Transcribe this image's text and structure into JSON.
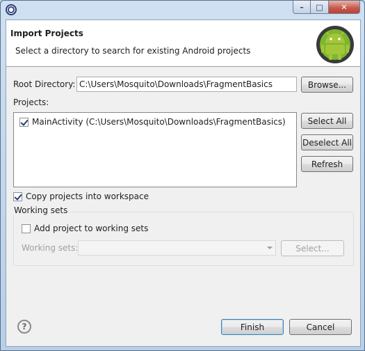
{
  "window": {
    "icon": "eclipse-icon",
    "controls": {
      "minimize": "–",
      "maximize": "□",
      "close": "✕"
    }
  },
  "header": {
    "title": "Import Projects",
    "message": "Select a directory to search for existing Android projects",
    "logo": "android-logo"
  },
  "root_directory": {
    "label": "Root Directory:",
    "value": "C:\\Users\\Mosquito\\Downloads\\FragmentBasics",
    "browse_label": "Browse..."
  },
  "projects": {
    "label": "Projects:",
    "items": [
      {
        "label": "MainActivity (C:\\Users\\Mosquito\\Downloads\\FragmentBasics)",
        "checked": true
      }
    ],
    "select_all_label": "Select All",
    "deselect_all_label": "Deselect All",
    "refresh_label": "Refresh"
  },
  "copy_into_workspace": {
    "label": "Copy projects into workspace",
    "checked": true
  },
  "working_sets": {
    "group_label": "Working sets",
    "add_label": "Add project to working sets",
    "add_checked": false,
    "field_label": "Working sets:",
    "select_label": "Select..."
  },
  "footer": {
    "help": "?",
    "finish_label": "Finish",
    "cancel_label": "Cancel"
  }
}
